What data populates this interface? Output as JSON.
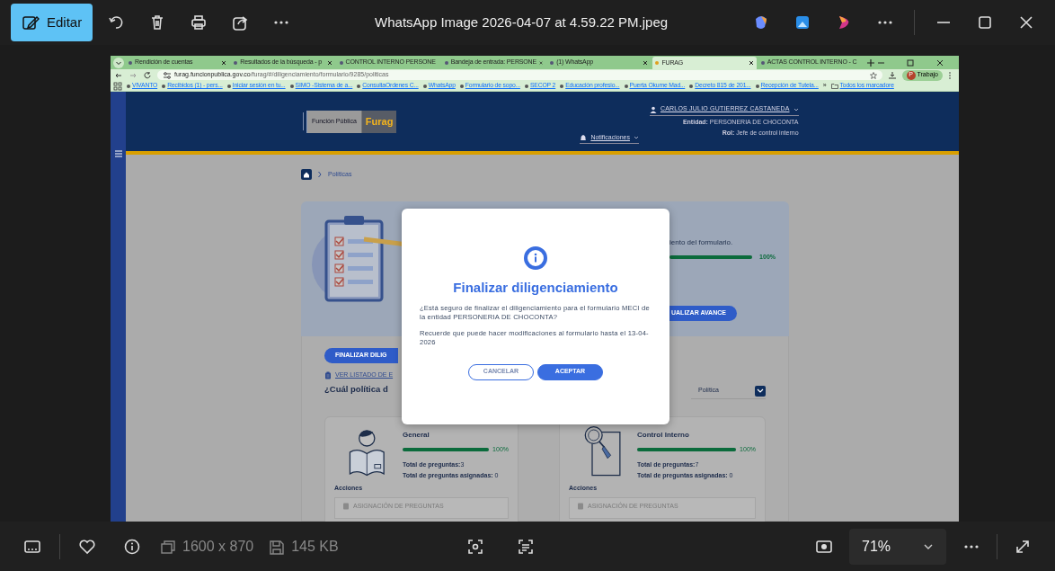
{
  "viewer": {
    "edit_button": "Editar",
    "file_name": "WhatsApp Image 2026-04-07 at 4.59.22 PM.jpeg",
    "dimensions": "1600 x 870",
    "file_size": "145 KB",
    "zoom": "71%"
  },
  "browser": {
    "tabs": [
      {
        "label": "Rendición de cuentas",
        "selected": false
      },
      {
        "label": "Resultados de la búsqueda - p",
        "selected": false
      },
      {
        "label": "CONTROL INTERNO PERSONE",
        "selected": false
      },
      {
        "label": "Bandeja de entrada: PERSONE",
        "selected": false
      },
      {
        "label": "(1) WhatsApp",
        "selected": false
      },
      {
        "label": "FURAG",
        "selected": true
      },
      {
        "label": "ACTAS CONTROL INTERNO - C",
        "selected": false
      }
    ],
    "url_host": "furag.funcionpublica.gov.co",
    "url_path": "/furag/#/diligenciamiento/formulario/9285/politicas",
    "profile_initial": "P",
    "profile": "Trabajo",
    "bookmarks": [
      "VIVANTO",
      "Recibidos (1) - pers...",
      "Iniciar sesión en tu...",
      "SIMO -Sistema de a...",
      "ConsultaOrdenes C...",
      "WhatsApp",
      "Formulario de sopo...",
      "SECOP 2",
      "Educación profesio...",
      "Puerta Okume Mad...",
      "Decreto 815 de 201...",
      "Recepción de Tutela..."
    ],
    "more_bookmarks": "»",
    "all_bookmarks": "Todos los marcadore"
  },
  "site": {
    "logo_left": "Función Pública",
    "logo_right": "Furag",
    "notifications": "Notificaciones",
    "user": "CARLOS JULIO GUTIERREZ CASTANEDA",
    "entity": "**Entidad:** PERSONERIA DE CHOCONTA",
    "role": "**Rol:** Jefe de control interno",
    "breadcrumb": "Políticas",
    "progress": {
      "text": "iento del formulario.",
      "level": 1,
      "reading": "100%",
      "button": "UALIZAR AVANCE"
    },
    "finalize_button": "FINALIZAR DILIG",
    "list_link": "VER LISTADO DE E",
    "question": "¿Cuál política d",
    "select": "Política",
    "cards": [
      {
        "kind": "reader",
        "title": "General",
        "level": 1,
        "reading": "100%",
        "total": "**Total de preguntas:**3",
        "assigned": "**Total de preguntas asignadas:** 0",
        "actions": "Acciones",
        "action_button": "ASIGNACIÓN DE PREGUNTAS"
      },
      {
        "kind": "magnifier",
        "title": "Control Interno",
        "level": 1,
        "reading": "100%",
        "total": "**Total de preguntas:**7",
        "assigned": "**Total de preguntas asignadas:** 0",
        "actions": "Acciones",
        "action_button": "ASIGNACIÓN DE PREGUNTAS"
      }
    ]
  },
  "modal": {
    "title": "Finalizar diligenciamiento",
    "paragraphs": [
      "¿Está seguro de finalizar el diligenciamiento para el formulario MECI de la entidad PERSONERIA DE CHOCONTA?",
      "Recuerde que puede hacer modificaciones al formulario hasta el 13-04-2026"
    ],
    "cancel": "CANCELAR",
    "accept": "ACEPTAR"
  }
}
